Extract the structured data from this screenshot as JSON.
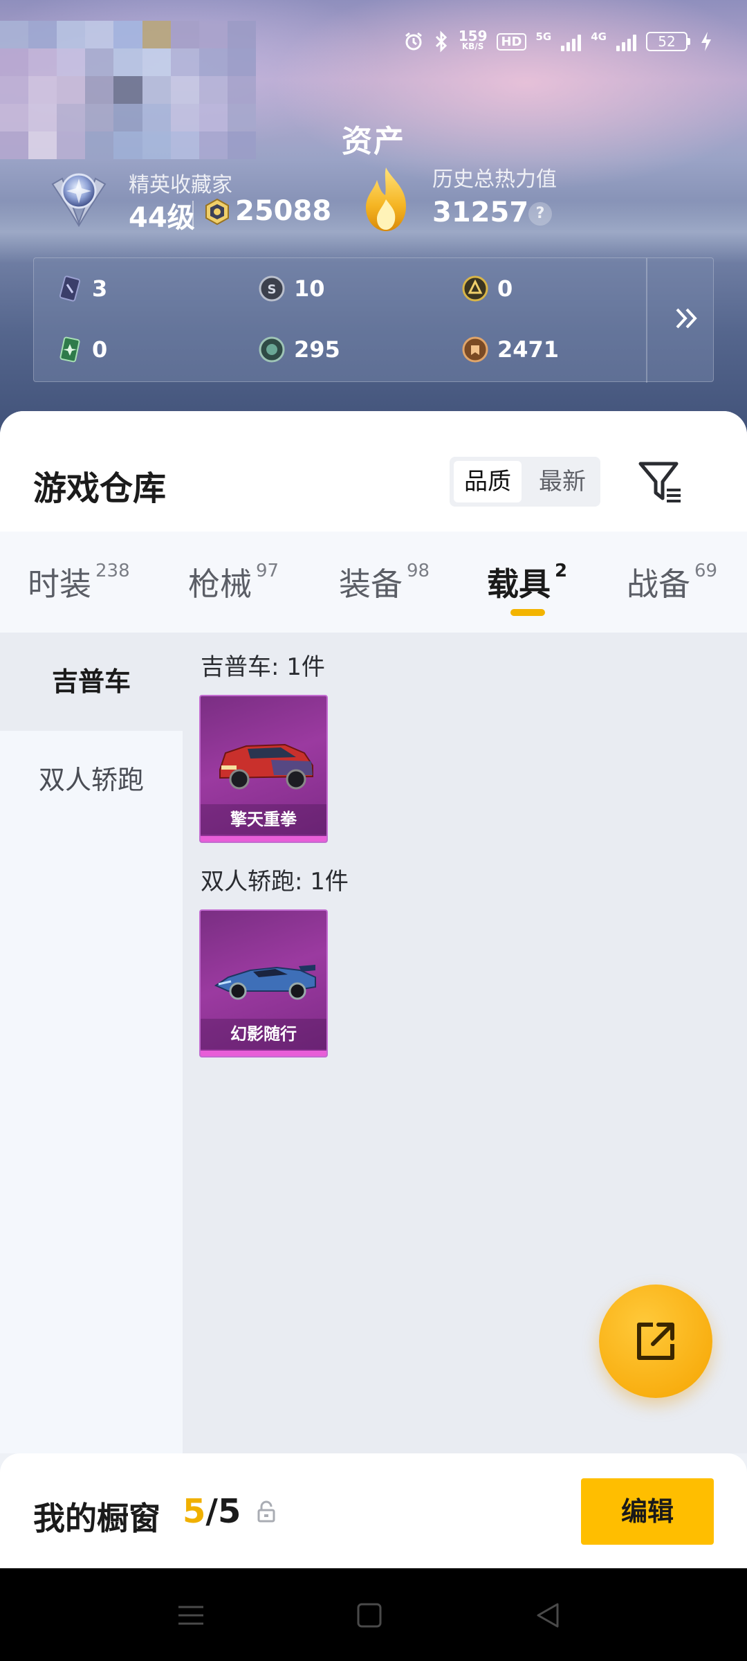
{
  "status_bar": {
    "network_speed": "159",
    "network_unit": "KB/S",
    "hd_label": "HD",
    "network_5g": "5G",
    "network_4g": "4G",
    "battery": "52",
    "icons": [
      "alarm-icon",
      "bluetooth-icon",
      "signal-icon",
      "charging-icon"
    ]
  },
  "assets": {
    "title": "资产",
    "rank_label": "精英收藏家",
    "level": "44级",
    "coins": "25088",
    "heat_label": "历史总热力值",
    "heat_value": "31257",
    "help": "?",
    "currencies": [
      {
        "icon": "card-ticket-icon",
        "value": "3"
      },
      {
        "icon": "silver-coin-icon",
        "value": "10"
      },
      {
        "icon": "gold-emblem-icon",
        "value": "0"
      },
      {
        "icon": "green-card-icon",
        "value": "0"
      },
      {
        "icon": "green-coin-icon",
        "value": "295"
      },
      {
        "icon": "bronze-medal-icon",
        "value": "2471"
      }
    ]
  },
  "warehouse": {
    "title": "游戏仓库",
    "sort_options": [
      "品质",
      "最新"
    ],
    "active_sort": "品质",
    "tabs": [
      {
        "label": "时装",
        "count": "238"
      },
      {
        "label": "枪械",
        "count": "97"
      },
      {
        "label": "装备",
        "count": "98"
      },
      {
        "label": "载具",
        "count": "2"
      },
      {
        "label": "战备",
        "count": "69"
      }
    ],
    "active_tab": "载具",
    "categories": [
      "吉普车",
      "双人轿跑"
    ],
    "active_category": "吉普车",
    "groups": [
      {
        "title": "吉普车: 1件",
        "items": [
          {
            "name": "擎天重拳"
          }
        ]
      },
      {
        "title": "双人轿跑: 1件",
        "items": [
          {
            "name": "幻影随行"
          }
        ]
      }
    ]
  },
  "showcase": {
    "label": "我的橱窗",
    "used": "5",
    "separator": "/",
    "total": "5",
    "edit_label": "编辑"
  },
  "colors": {
    "accent": "#FFBE00",
    "tab_underline": "#F3B400",
    "card_purple": "#9B3AA0"
  }
}
